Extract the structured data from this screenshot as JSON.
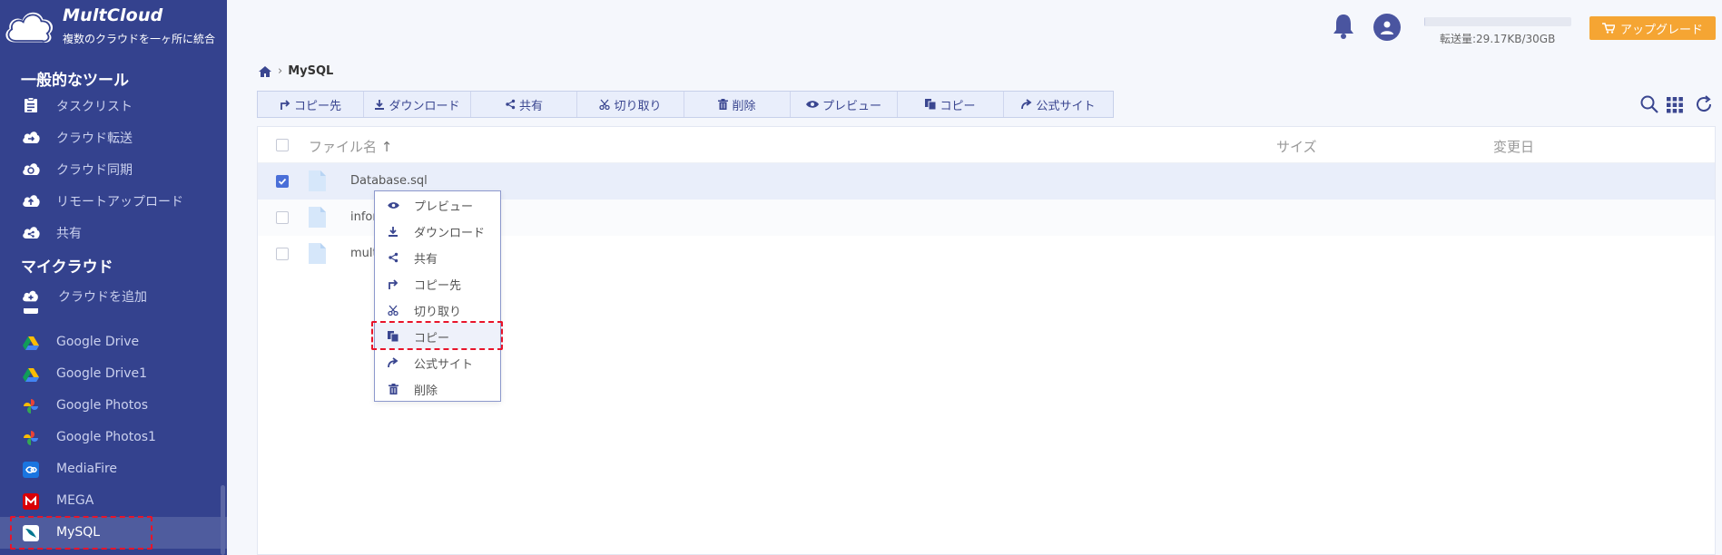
{
  "app": {
    "name": "MultCloud",
    "tagline": "複数のクラウドを一ヶ所に統合"
  },
  "header": {
    "traffic_text": "転送量:29.17KB/30GB",
    "traffic_used_fraction": 0.001,
    "upgrade_label": "アップグレード",
    "colors": {
      "upgrade": "#f5a533",
      "sidebar": "#34428e"
    }
  },
  "sidebar": {
    "section_tools": "一般的なツール",
    "tools": [
      {
        "label": "タスクリスト",
        "icon": "clipboard-icon"
      },
      {
        "label": "クラウド転送",
        "icon": "cloud-transfer-icon"
      },
      {
        "label": "クラウド同期",
        "icon": "cloud-sync-icon"
      },
      {
        "label": "リモートアップロード",
        "icon": "cloud-upload-icon"
      },
      {
        "label": "共有",
        "icon": "cloud-share-icon"
      }
    ],
    "section_clouds": "マイクラウド",
    "add_cloud": "クラウドを追加",
    "clouds": [
      {
        "label": "Google Drive",
        "icon": "google-drive-icon"
      },
      {
        "label": "Google Drive1",
        "icon": "google-drive-icon"
      },
      {
        "label": "Google Photos",
        "icon": "google-photos-icon"
      },
      {
        "label": "Google Photos1",
        "icon": "google-photos-icon"
      },
      {
        "label": "MediaFire",
        "icon": "mediafire-icon"
      },
      {
        "label": "MEGA",
        "icon": "mega-icon"
      },
      {
        "label": "MySQL",
        "icon": "mysql-icon"
      }
    ]
  },
  "breadcrumb": {
    "current": "MySQL"
  },
  "toolbar": {
    "copy_to": "コピー先",
    "download": "ダウンロード",
    "share": "共有",
    "cut": "切り取り",
    "delete": "削除",
    "preview": "プレビュー",
    "copy": "コピー",
    "official_site": "公式サイト"
  },
  "list": {
    "col_name": "ファイル名",
    "col_size": "サイズ",
    "col_modified": "変更日",
    "sort_arrow": "↑",
    "files": [
      {
        "name": "Database.sql",
        "selected": true
      },
      {
        "name": "infor",
        "selected": false
      },
      {
        "name": "mult",
        "selected": false
      }
    ]
  },
  "context_menu": {
    "items": [
      {
        "label": "プレビュー",
        "icon": "eye-icon"
      },
      {
        "label": "ダウンロード",
        "icon": "download-icon"
      },
      {
        "label": "共有",
        "icon": "share-icon"
      },
      {
        "label": "コピー先",
        "icon": "copy-to-icon"
      },
      {
        "label": "切り取り",
        "icon": "scissors-icon"
      },
      {
        "label": "コピー",
        "icon": "copy-icon"
      },
      {
        "label": "公式サイト",
        "icon": "external-arrow-icon"
      },
      {
        "label": "削除",
        "icon": "trash-icon"
      }
    ],
    "highlighted": "コピー"
  }
}
